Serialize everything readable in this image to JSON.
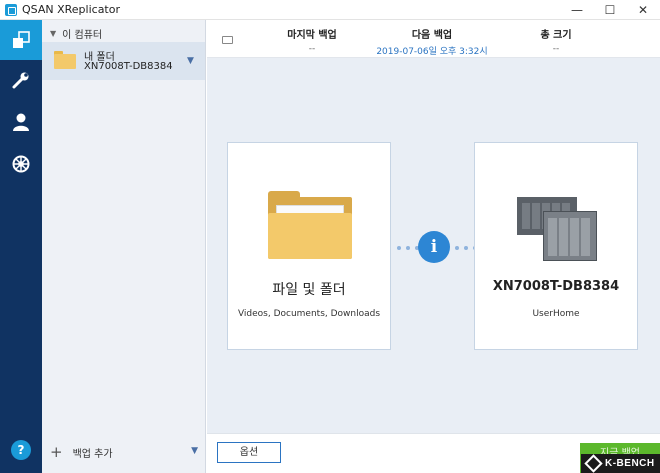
{
  "window": {
    "title": "QSAN XReplicator",
    "minimize": "—",
    "maximize": "☐",
    "close": "✕"
  },
  "rail": {
    "items": [
      {
        "name": "backup",
        "icon": "backup-icon",
        "active": true
      },
      {
        "name": "tools",
        "icon": "wrench-icon",
        "active": false
      },
      {
        "name": "account",
        "icon": "user-icon",
        "active": false
      },
      {
        "name": "settings",
        "icon": "gear-icon",
        "active": false
      }
    ],
    "help": "?"
  },
  "tree": {
    "header": "이 컴퓨터",
    "item": {
      "name": "내 폴더",
      "subtitle": "XN7008T-DB8384"
    },
    "add_backup": "백업 추가"
  },
  "summary": {
    "last_backup_label": "마지막 백업",
    "last_backup_value": "--",
    "next_backup_label": "다음 백업",
    "next_backup_value": "2019-07-06일 오후 3:32시",
    "total_size_label": "총 크기",
    "total_size_value": "--"
  },
  "source": {
    "title": "파일 및 폴더",
    "subtitle": "Videos, Documents, Downloads"
  },
  "destination": {
    "title": "XN7008T-DB8384",
    "subtitle": "UserHome"
  },
  "info_symbol": "i",
  "buttons": {
    "options": "옵션",
    "backup_now": "지금 백업"
  },
  "watermark": "K-BENCH",
  "colors": {
    "rail": "#103362",
    "accent": "#1a9bd8",
    "primary": "#2d86d4",
    "backup_button": "#5cb82c",
    "folder": "#f3c96a"
  }
}
